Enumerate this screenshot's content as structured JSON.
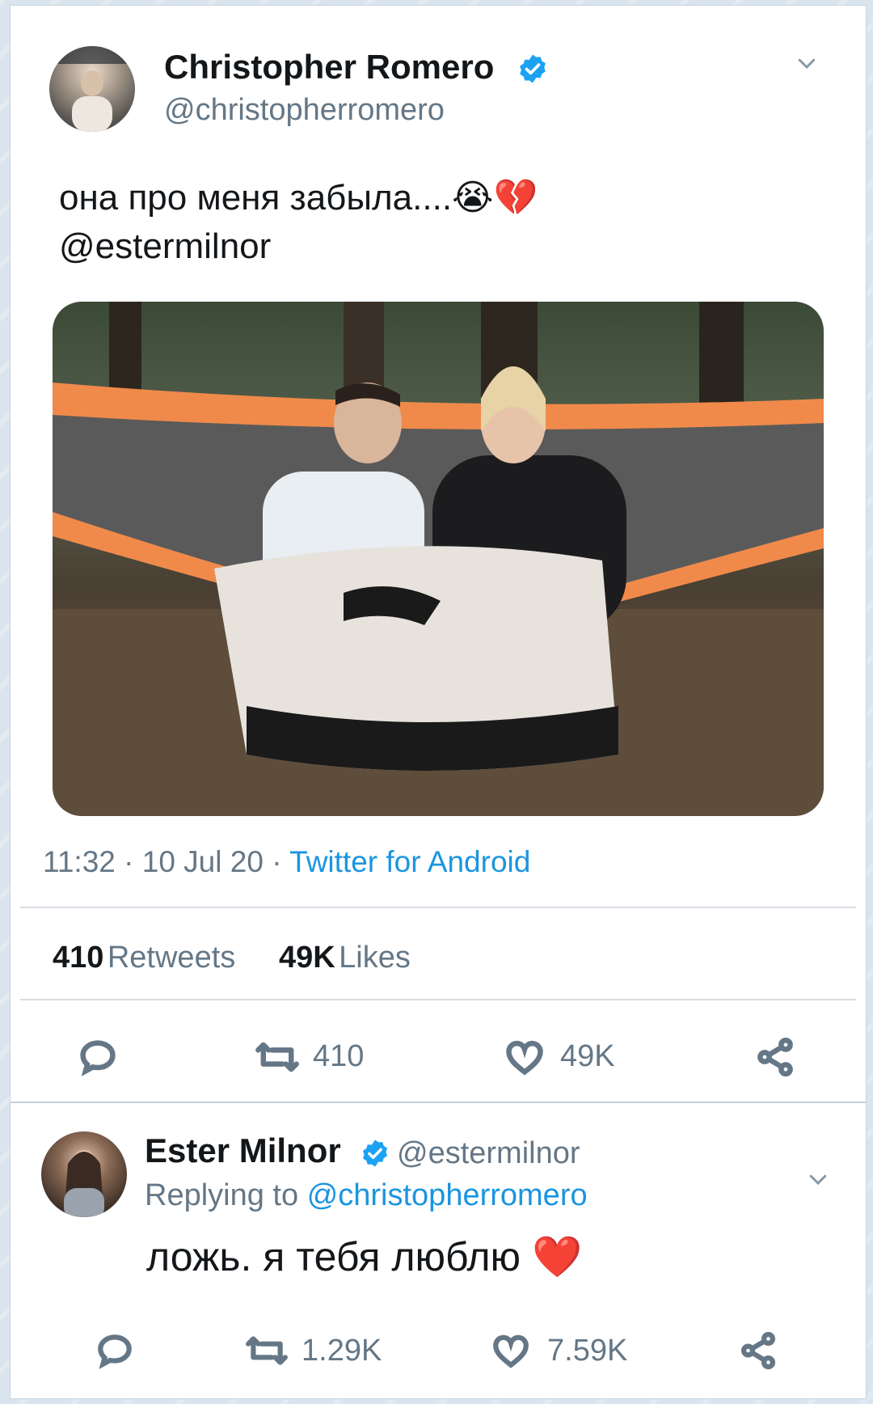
{
  "tweet": {
    "author_name": "Christopher Romero",
    "author_handle": "@christopherromero",
    "text_line1": "она про меня забыла....😭💔",
    "text_line2": "@estermilnor",
    "timestamp": "11:32",
    "date": "10 Jul 20",
    "source": "Twitter for Android",
    "retweets_count": "410",
    "retweets_label": "Retweets",
    "likes_count": "49K",
    "likes_label": "Likes",
    "action_retweets": "410",
    "action_likes": "49K"
  },
  "reply": {
    "author_name": "Ester Milnor",
    "author_handle": "@estermilnor",
    "replying_prefix": "Replying to",
    "replying_to": "@christopherromero",
    "text": "ложь. я тебя люблю ❤️",
    "action_retweets": "1.29K",
    "action_likes": "7.59K"
  },
  "colors": {
    "link": "#1b95e0",
    "verified": "#1da1f2",
    "muted": "#657786"
  }
}
